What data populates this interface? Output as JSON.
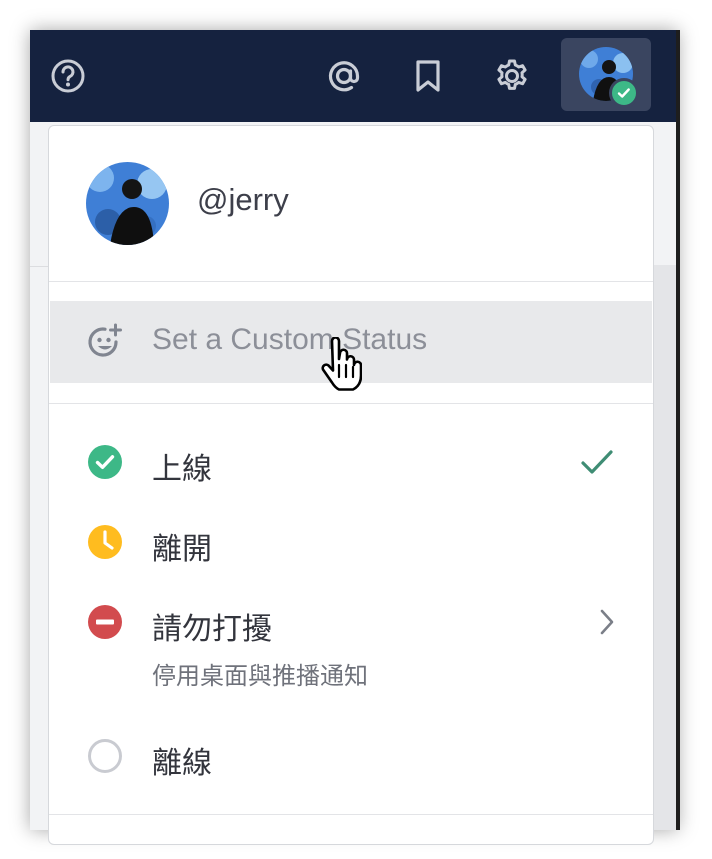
{
  "topbar": {
    "icons": [
      "help-icon",
      "mention-icon",
      "bookmark-icon",
      "gear-icon"
    ],
    "background": "#15223f"
  },
  "profile": {
    "username": "@jerry"
  },
  "custom_status": {
    "placeholder": "Set a Custom Status",
    "icon": "emoji-add-icon"
  },
  "statuses": [
    {
      "label": "上線",
      "color": "#3db887",
      "icon": "online-check-icon",
      "selected": true
    },
    {
      "label": "離開",
      "color": "#ffbc1f",
      "icon": "away-clock-icon"
    },
    {
      "label": "請勿打擾",
      "sublabel": "停用桌面與推播通知",
      "color": "#d24b4e",
      "icon": "dnd-minus-icon",
      "has_submenu": true
    },
    {
      "label": "離線",
      "color": "#c9cbd1",
      "icon": "offline-circle-icon"
    }
  ]
}
